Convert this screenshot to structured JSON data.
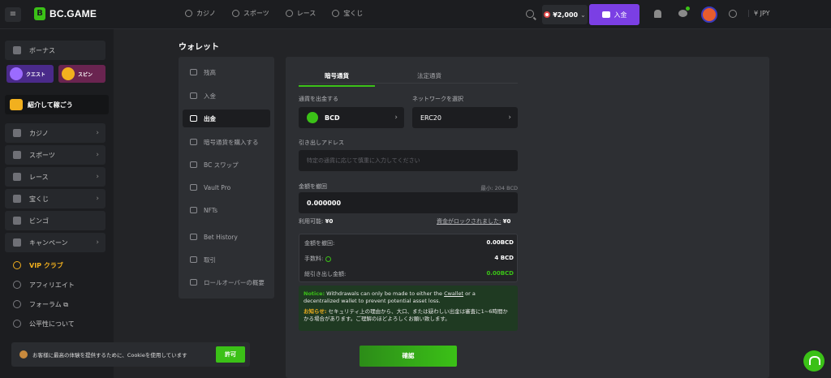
{
  "header": {
    "menu_icon": "hamburger-icon",
    "logo_text": "BC.GAME",
    "nav": [
      {
        "label": "カジノ",
        "icon": "casino-icon"
      },
      {
        "label": "スポーツ",
        "icon": "sports-icon"
      },
      {
        "label": "レース",
        "icon": "race-icon"
      },
      {
        "label": "宝くじ",
        "icon": "lottery-icon"
      }
    ],
    "balance": "¥2,000",
    "balance_chevron": "⌄",
    "deposit_label": "入金",
    "currency": "¥ JPY"
  },
  "sidebar": {
    "bonus": "ボーナス",
    "quest": "クエスト",
    "spin": "スピン",
    "refer": "紹介して稼ごう",
    "chevron": "›",
    "items": [
      {
        "label": "カジノ",
        "chevron": true
      },
      {
        "label": "スポーツ",
        "chevron": true
      },
      {
        "label": "レース",
        "chevron": true
      },
      {
        "label": "宝くじ",
        "chevron": true
      },
      {
        "label": "ビンゴ",
        "chevron": false
      },
      {
        "label": "キャンペーン",
        "chevron": true
      }
    ],
    "plain": [
      {
        "label": "VIP クラブ"
      },
      {
        "label": "アフィリエイト"
      },
      {
        "label": "フォーラム ⧉"
      },
      {
        "label": "公平性について"
      }
    ]
  },
  "cookie": {
    "text": "お客様に最高の体験を提供するために、Cookieを使用しています",
    "button": "許可"
  },
  "page_title": "ウォレット",
  "wallet_menu": [
    {
      "label": "残高"
    },
    {
      "label": "入金"
    },
    {
      "label": "出金"
    },
    {
      "label": "暗号通貨を購入する"
    },
    {
      "label": "BC スワップ"
    },
    {
      "label": "Vault Pro"
    },
    {
      "label": "NFTs"
    },
    {
      "label": "Bet History"
    },
    {
      "label": "取引"
    },
    {
      "label": "ロールオーバーの概要"
    }
  ],
  "withdraw": {
    "tabs": [
      "暗号通貨",
      "法定通貨"
    ],
    "currency_label": "通貨を出金する",
    "currency_value": "BCD",
    "network_label": "ネットワークを選択",
    "network_value": "ERC20",
    "select_chevron": "›",
    "address_label": "引き出しアドレス",
    "address_placeholder": "特定の通貨に応じて慎重に入力してください",
    "amount_label": "金額を撤回",
    "amount_min": "最小: 204 BCD",
    "amount_value": "0.000000",
    "available_label": "利用可能:",
    "available_value": "¥0",
    "locked_label": "資金がロックされました:",
    "locked_value": "¥0",
    "summary": {
      "withdraw_label": "金額を撤回:",
      "withdraw_value": "0.00BCD",
      "fee_label": "手数料:",
      "fee_value": "4 BCD",
      "total_label": "総引き出し金額:",
      "total_value": "0.00BCD"
    },
    "notice_en_prefix": "Notice:",
    "notice_en_a": " Withdrawals can only be made to either the ",
    "notice_en_link": "Cwallet",
    "notice_en_b": " or a decentralized wallet to prevent potential asset loss.",
    "notice_jp_prefix": "お知らせ:",
    "notice_jp_text": " セキュリティ上の理由から、大口、または疑わしい出金は審査に1~6時間かかる場合があります。ご理解のほどよろしくお願い致します。",
    "confirm": "確認"
  }
}
